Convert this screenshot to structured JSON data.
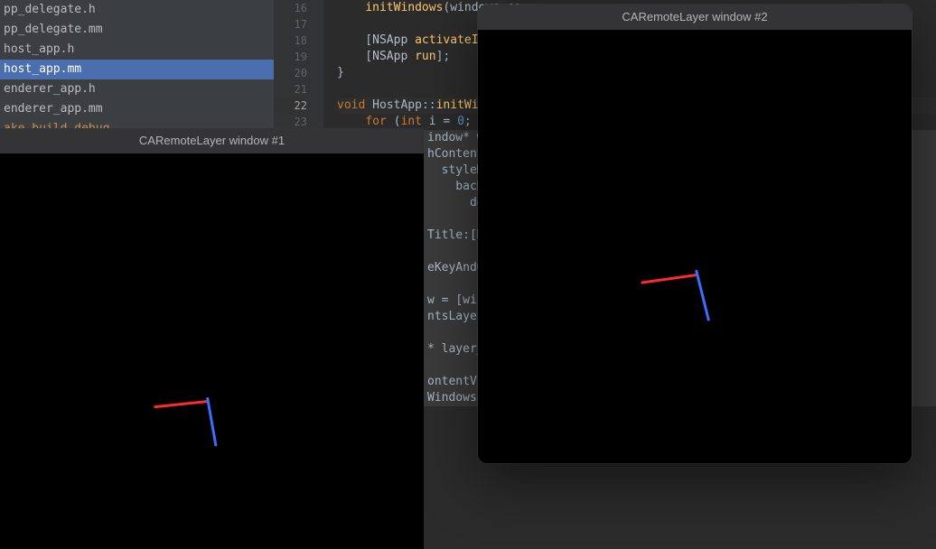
{
  "sidebar": {
    "files": [
      "pp_delegate.h",
      "pp_delegate.mm",
      "host_app.h",
      "host_app.mm",
      "enderer_app.h",
      "enderer_app.mm",
      "ake-build-debug"
    ],
    "selected_index": 3,
    "build_index": 6
  },
  "gutter": {
    "lines": [
      "16",
      "17",
      "18",
      "19",
      "20",
      "21",
      "22",
      "23"
    ]
  },
  "code": {
    "lines": [
      {
        "segments": [
          {
            "t": "    ",
            "c": ""
          },
          {
            "t": "initWindows",
            "c": "fn"
          },
          {
            "t": "(windows_co",
            "c": ""
          }
        ]
      },
      {
        "segments": []
      },
      {
        "segments": [
          {
            "t": "    [",
            "c": ""
          },
          {
            "t": "NSApp",
            "c": "type"
          },
          {
            "t": " ",
            "c": ""
          },
          {
            "t": "activateIgnorin",
            "c": "fn"
          }
        ]
      },
      {
        "segments": [
          {
            "t": "    [",
            "c": ""
          },
          {
            "t": "NSApp",
            "c": "type"
          },
          {
            "t": " ",
            "c": ""
          },
          {
            "t": "run",
            "c": "fn"
          },
          {
            "t": "];",
            "c": ""
          }
        ]
      },
      {
        "segments": [
          {
            "t": "}",
            "c": ""
          }
        ]
      },
      {
        "segments": []
      },
      {
        "segments": [
          {
            "t": "void ",
            "c": "kw"
          },
          {
            "t": "HostApp",
            "c": "cls"
          },
          {
            "t": "::",
            "c": ""
          },
          {
            "t": "initWindow",
            "c": "fn"
          }
        ]
      },
      {
        "segments": [
          {
            "t": "    ",
            "c": ""
          },
          {
            "t": "for ",
            "c": "kw"
          },
          {
            "t": "(",
            "c": ""
          },
          {
            "t": "int ",
            "c": "kw"
          },
          {
            "t": "i = ",
            "c": ""
          },
          {
            "t": "0",
            "c": "num"
          },
          {
            "t": "; i < w",
            "c": ""
          }
        ]
      }
    ],
    "partial_lines": [
      "indow* wi",
      "hContentH",
      "  styleM",
      "    bacK",
      "      de",
      "",
      "Title:[NS",
      "",
      "eKeyAndOr",
      "",
      "w = [wind",
      "ntsLayer",
      "",
      "* layer_h",
      "",
      "ontentVie",
      "Windows"
    ]
  },
  "windows": {
    "win1": {
      "title": "CARemoteLayer window #1"
    },
    "win2": {
      "title": "CARemoteLayer window #2"
    }
  }
}
